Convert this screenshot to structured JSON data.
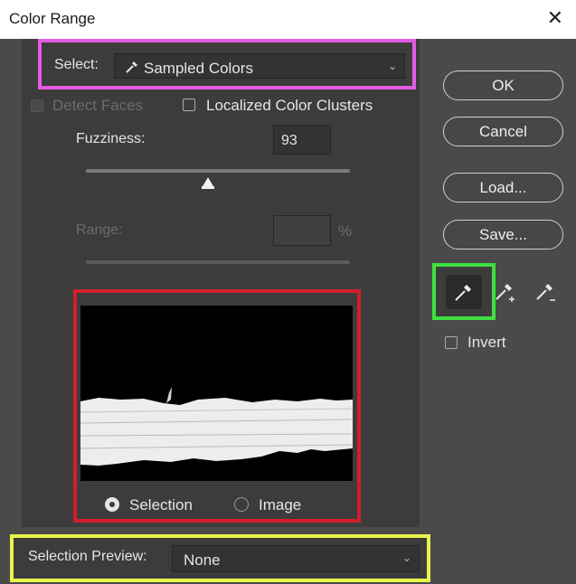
{
  "window": {
    "title": "Color Range"
  },
  "select": {
    "label": "Select:",
    "value": "Sampled Colors"
  },
  "options": {
    "detect_faces": "Detect Faces",
    "localized_clusters": "Localized Color Clusters"
  },
  "fuzziness": {
    "label": "Fuzziness:",
    "value": "93"
  },
  "range": {
    "label": "Range:",
    "value": "",
    "unit": "%"
  },
  "preview": {
    "selection_label": "Selection",
    "image_label": "Image",
    "selected": "Selection"
  },
  "selection_preview": {
    "label": "Selection Preview:",
    "value": "None"
  },
  "buttons": {
    "ok": "OK",
    "cancel": "Cancel",
    "load": "Load...",
    "save": "Save..."
  },
  "invert": {
    "label": "Invert",
    "checked": false
  },
  "tools": [
    "eyedropper-icon",
    "eyedropper-plus-icon",
    "eyedropper-minus-icon"
  ],
  "colors": {
    "highlight_select": "#e35be3",
    "highlight_preview": "#d21f2b",
    "highlight_bottom": "#e8f54a",
    "highlight_tool": "#3fe03f"
  }
}
